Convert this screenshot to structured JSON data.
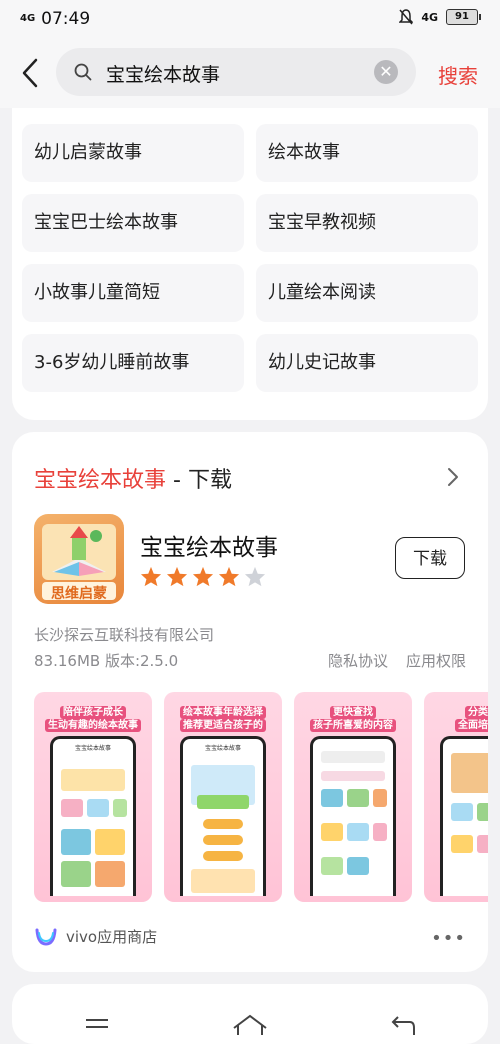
{
  "status_bar": {
    "signal": "4G",
    "time": "07:49",
    "network": "4G",
    "battery": "91"
  },
  "search": {
    "query": "宝宝绘本故事",
    "button_label": "搜索"
  },
  "suggestions": [
    "幼儿启蒙故事",
    "绘本故事",
    "宝宝巴士绘本故事",
    "宝宝早教视频",
    "小故事儿童简短",
    "儿童绘本阅读",
    "3-6岁幼儿睡前故事",
    "幼儿史记故事"
  ],
  "app_card": {
    "title_highlight": "宝宝绘本故事",
    "title_suffix": " - 下载",
    "app_name": "宝宝绘本故事",
    "rating_stars": 4,
    "download_label": "下载",
    "developer": "长沙探云互联科技有限公司",
    "size_version": "83.16MB 版本:2.5.0",
    "privacy_label": "隐私协议",
    "permissions_label": "应用权限",
    "icon_caption": "思维启蒙",
    "screenshots": [
      {
        "caption_line1": "陪伴孩子成长",
        "caption_line2": "生动有趣的绘本故事",
        "phone_title": "宝宝绘本故事"
      },
      {
        "caption_line1": "绘本故事年龄选择",
        "caption_line2": "推荐更适合孩子的",
        "phone_title": "宝宝绘本故事"
      },
      {
        "caption_line1": "更快查找",
        "caption_line2": "孩子所喜爱的内容",
        "phone_title": ""
      },
      {
        "caption_line1": "分类区",
        "caption_line2": "全面培养孩",
        "phone_title": ""
      }
    ],
    "store_name": "vivo应用商店",
    "more_label": "•••"
  },
  "colors": {
    "accent": "#e8413a",
    "star_on": "#f07a2a",
    "star_off": "#cfd2d8"
  }
}
